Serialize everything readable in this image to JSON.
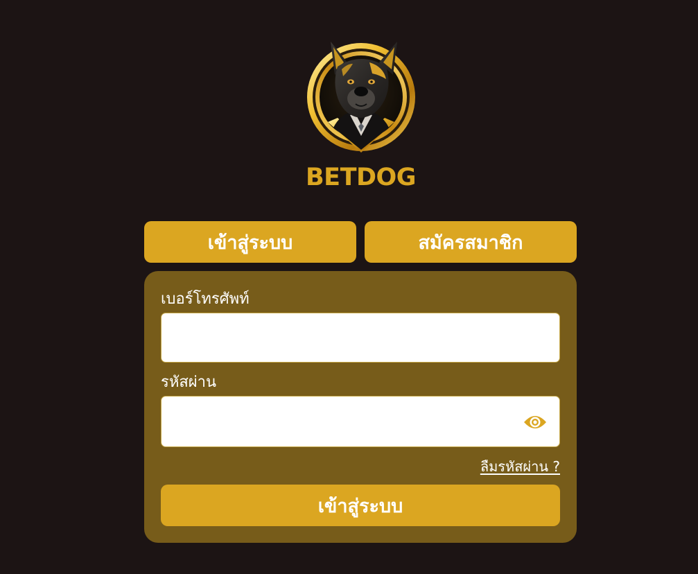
{
  "brand": {
    "name": "BETDOG",
    "logo_icon": "dog-mascot-logo-icon",
    "accent_color": "#dba621"
  },
  "tabs": {
    "login_label": "เข้าสู่ระบบ",
    "register_label": "สมัครสมาชิก",
    "active": "login"
  },
  "form": {
    "phone_label": "เบอร์โทรศัพท์",
    "phone_value": "",
    "phone_placeholder": "",
    "password_label": "รหัสผ่าน",
    "password_value": "",
    "password_placeholder": "",
    "show_password_icon": "eye-icon",
    "forgot_label": "ลืมรหัสผ่าน ?",
    "submit_label": "เข้าสู่ระบบ"
  },
  "colors": {
    "background": "#1c1414",
    "card": "#775c1a",
    "button": "#dba621"
  }
}
